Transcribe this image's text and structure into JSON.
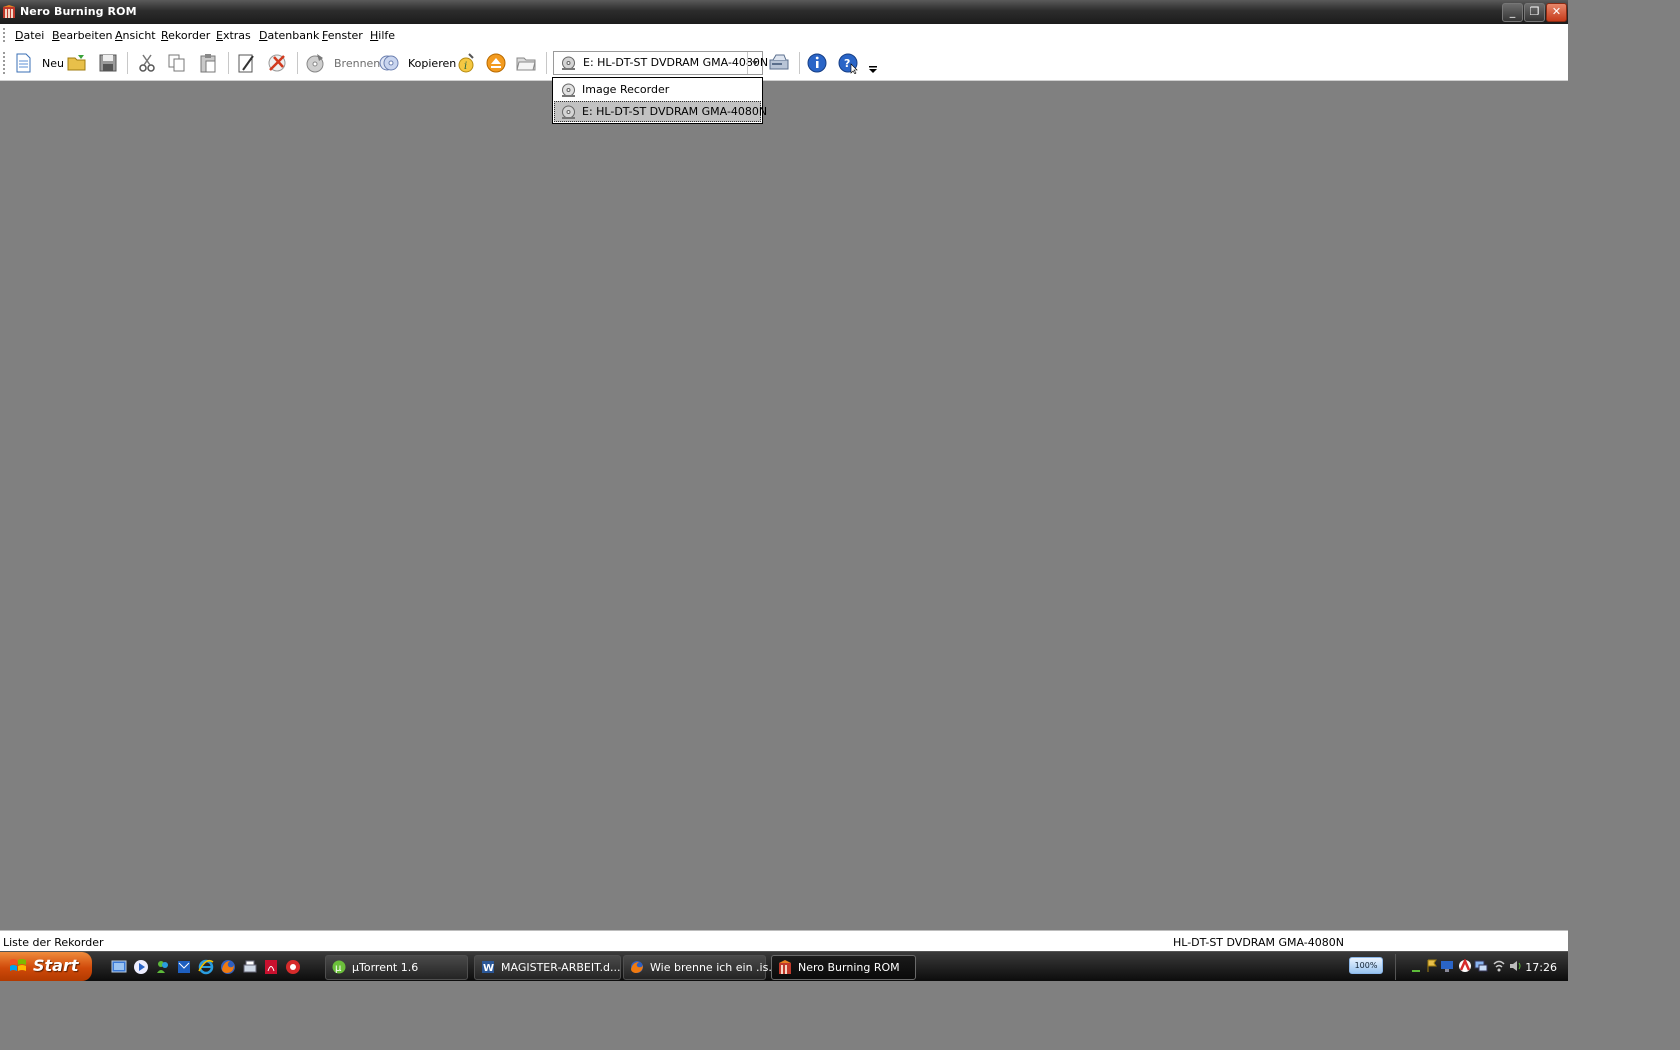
{
  "window": {
    "title": "Nero Burning ROM",
    "minimize_glyph": "_",
    "restore_glyph": "❐",
    "close_glyph": "✕"
  },
  "menu": {
    "items": [
      {
        "first": "D",
        "rest": "atei"
      },
      {
        "first": "B",
        "rest": "earbeiten"
      },
      {
        "first": "A",
        "rest": "nsicht"
      },
      {
        "first": "R",
        "rest": "ekorder"
      },
      {
        "first": "E",
        "rest": "xtras"
      },
      {
        "first": "D",
        "rest": "atenbank"
      },
      {
        "first": "F",
        "rest": "enster"
      },
      {
        "first": "H",
        "rest": "ilfe"
      }
    ]
  },
  "toolbar": {
    "new_label": "Neu",
    "burn_label": "Brennen",
    "copy_label": "Kopieren",
    "recorder_value": "E: HL-DT-ST DVDRAM GMA-4080N",
    "icons": [
      "new-document-icon",
      "open-folder-icon",
      "save-icon",
      "cut-icon",
      "copy-icon",
      "paste-icon",
      "edit-icon",
      "erase-disc-icon",
      "burn-icon",
      "copy-disc-icon",
      "info-icon",
      "eject-icon",
      "browse-folder-icon",
      "recorder-icon",
      "about-icon",
      "help-icon"
    ]
  },
  "recorder_dropdown": {
    "options": [
      "Image Recorder",
      "E: HL-DT-ST DVDRAM GMA-4080N"
    ],
    "selected_index": 1
  },
  "statusbar": {
    "left": "Liste der Rekorder",
    "right": "HL-DT-ST DVDRAM GMA-4080N"
  },
  "taskbar": {
    "start_label": "Start",
    "tasks": [
      {
        "label": "µTorrent 1.6",
        "icon": "utorrent-icon"
      },
      {
        "label": "MAGISTER-ARBEIT.d...",
        "icon": "word-icon"
      },
      {
        "label": "Wie brenne ich ein .is...",
        "icon": "firefox-icon"
      },
      {
        "label": "Nero Burning ROM",
        "icon": "nero-icon",
        "active": true
      }
    ],
    "battery": "100%",
    "clock": "17:26"
  },
  "colors": {
    "workspace": "#808080",
    "titlebar": "#2c2c2c",
    "start_button": "#d04a0a"
  }
}
